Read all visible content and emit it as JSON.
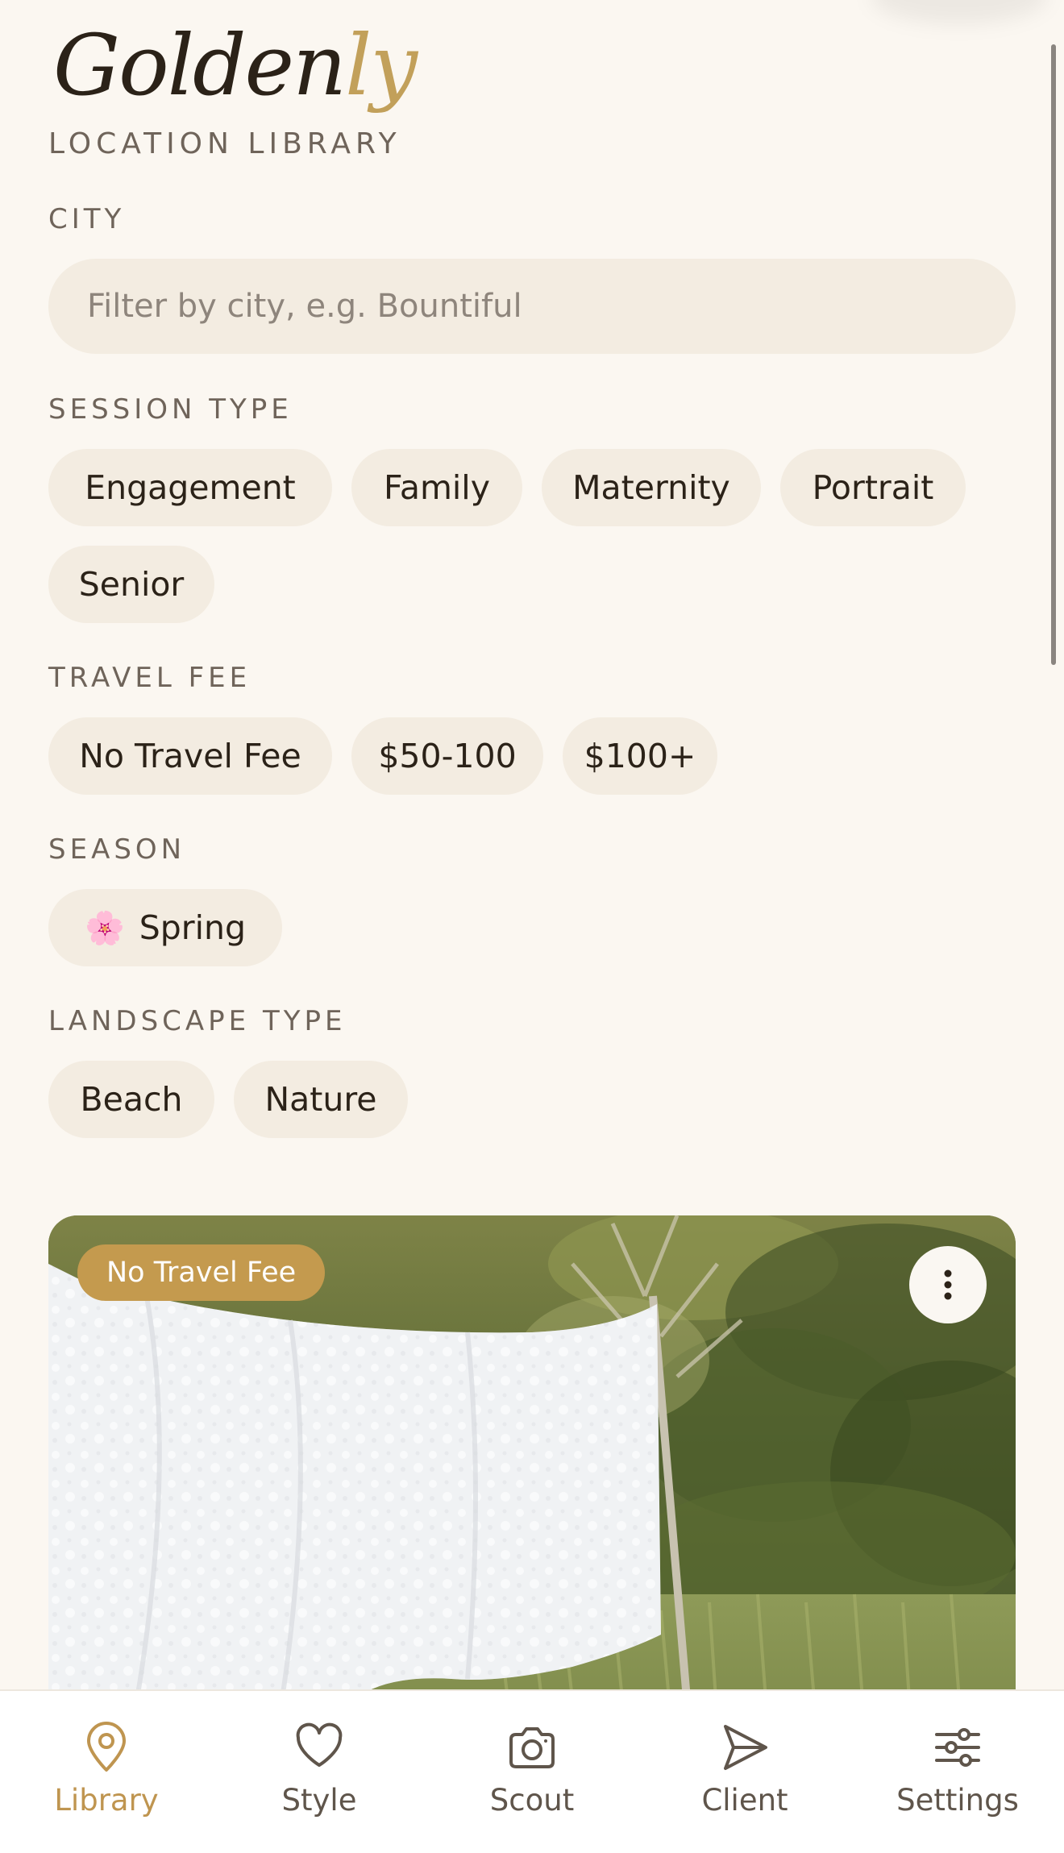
{
  "app": {
    "logo_main": "Golden",
    "logo_accent": "ly",
    "subtitle": "LOCATION LIBRARY"
  },
  "filters": {
    "city": {
      "label": "CITY",
      "value": "",
      "placeholder": "Filter by city, e.g. Bountiful"
    },
    "session_type": {
      "label": "SESSION TYPE",
      "options": [
        "Engagement",
        "Family",
        "Maternity",
        "Portrait",
        "Senior"
      ]
    },
    "travel_fee": {
      "label": "TRAVEL FEE",
      "options": [
        "No Travel Fee",
        "$50-100",
        "$100+"
      ]
    },
    "season": {
      "label": "SEASON",
      "options": [
        {
          "emoji": "🌸",
          "label": "Spring"
        }
      ]
    },
    "landscape_type": {
      "label": "LANDSCAPE TYPE",
      "options": [
        "Beach",
        "Nature"
      ]
    }
  },
  "card": {
    "badge": "No Travel Fee",
    "menu_icon": "more-vertical-icon"
  },
  "bottom_nav": {
    "items": [
      {
        "label": "Library",
        "icon": "map-pin-icon",
        "active": true
      },
      {
        "label": "Style",
        "icon": "heart-icon",
        "active": false
      },
      {
        "label": "Scout",
        "icon": "camera-icon",
        "active": false
      },
      {
        "label": "Client",
        "icon": "send-icon",
        "active": false
      },
      {
        "label": "Settings",
        "icon": "sliders-icon",
        "active": false
      }
    ]
  },
  "colors": {
    "background": "#FBF7F1",
    "chip": "#F3ECE1",
    "accent": "#C2A05A",
    "badge": "#C49A4E",
    "text": "#2B2218",
    "muted": "#6F645A"
  }
}
